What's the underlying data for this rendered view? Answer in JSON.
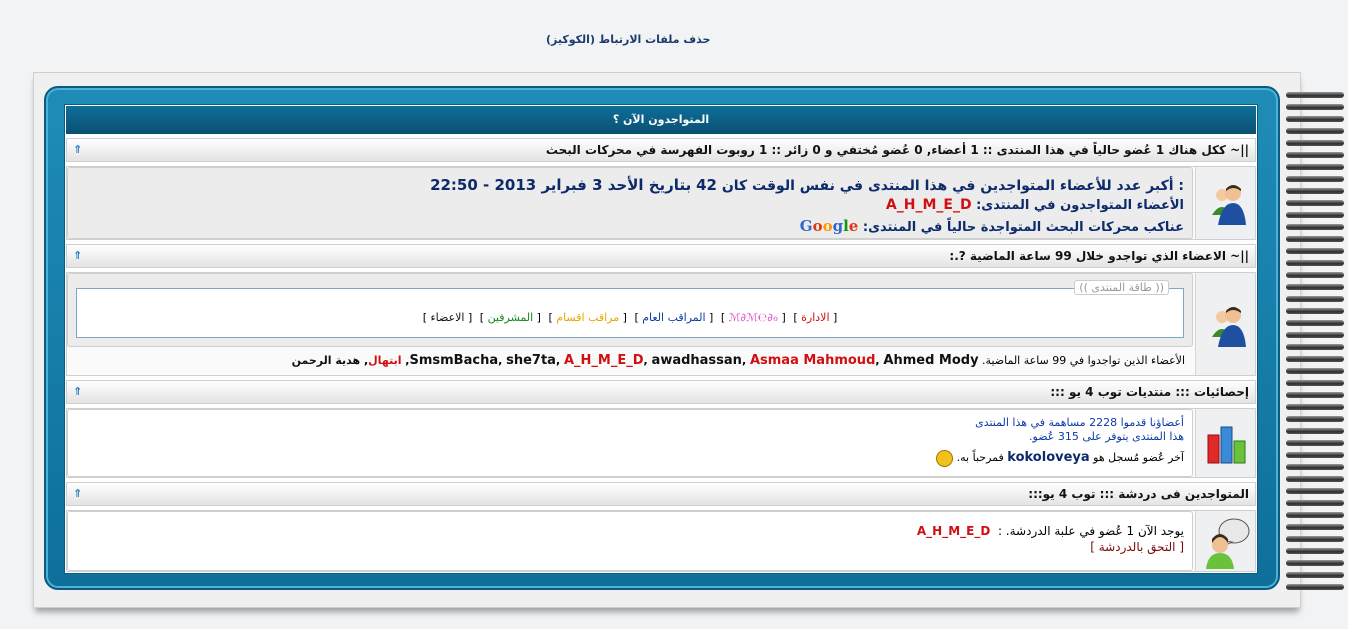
{
  "top_link": "حذف ملفات الارتباط (الكوكيز)",
  "panel_title": "المتواجدون الآن ؟",
  "section1": {
    "header": "||~ ككل هناك 1 عُضو حالياً في هذا المنتدى :: 1 أعضاء, 0 عُضو مُختفي و 0 زائر :: 1 روبوت الفهرسة في محركات البحث",
    "record_line": ": أكبر عدد للأعضاء المتواجدين في هذا المنتدى في نفس الوقت كان 42 بتاريخ الأحد 3 فبراير 2013 - 22:50",
    "record_prefix": ": أكبر عدد للأعضاء المتواجدين في هذا المنتدى في نفس الوقت كان",
    "record_count": "42",
    "record_date": "بتاريخ الأحد 3 فبراير 2013 - 22:50",
    "online_label": "الأعضاء المتواجدون في المنتدى:",
    "online_user": "A_H_M_E_D",
    "bots_label": "عناكب محركات البحث المتواجدة حالياً في المنتدى:",
    "bot_name": "Google"
  },
  "section2": {
    "header": "||~ الاعضاء الذي تواجدو خلال 99 ساعة الماضية ?.:",
    "legend_title": "(( طاقة المنتدى ))",
    "groups": [
      {
        "label": "الادارة",
        "color": "#d10f12"
      },
      {
        "label": "ℳ∂ℳ℮∂ℴ",
        "color": "#e04fd0"
      },
      {
        "label": "المراقب العام",
        "color": "#0c3aa8"
      },
      {
        "label": "مراقب اقسام",
        "color": "#e8a400"
      },
      {
        "label": "المشرفين",
        "color": "#148a1c"
      },
      {
        "label": "الاعضاء",
        "color": "#111111"
      }
    ],
    "members_label": "الأعضاء الذين تواجدوا في 99 ساعة الماضية.",
    "members": [
      {
        "name": "SmsmBacha",
        "color": "#111111"
      },
      {
        "name": "she7ta",
        "color": "#111111"
      },
      {
        "name": "A_H_M_E_D",
        "color": "#d10f12"
      },
      {
        "name": "awadhassan",
        "color": "#111111"
      },
      {
        "name": "Asmaa Mahmoud",
        "color": "#d10f12"
      },
      {
        "name": "Ahmed Mody",
        "color": "#111111"
      },
      {
        "name": "ابتهال",
        "color": "#d10f12"
      },
      {
        "name": "هدية الرحمن",
        "color": "#111111"
      }
    ]
  },
  "section3": {
    "header": "إحصائيات ::: منتديات توب 4 يو :::",
    "posts_line": "أعضاؤنا قدموا 2228 مساهمة في هذا المنتدى",
    "members_line": "هذا المنتدى يتوفر على 315 عُضو.",
    "newest_prefix": "آخر عُضو مُسجل هو",
    "newest_user": "kokoloveya",
    "newest_suffix": "فمرحباً به."
  },
  "section4": {
    "header": "المتواجدين فى دردشة ::: توب 4 يو:::",
    "chat_line_prefix": "يوجد الآن 1 عُضو في علبة الدردشة. :",
    "chat_user": "A_H_M_E_D",
    "chat_link": "[ التحق بالدردشة ]"
  },
  "colors": {
    "frame": "#1f8cb8",
    "title_bar": "#0e6f99",
    "accent_red": "#d10f12",
    "navy": "#0d2a6b"
  }
}
